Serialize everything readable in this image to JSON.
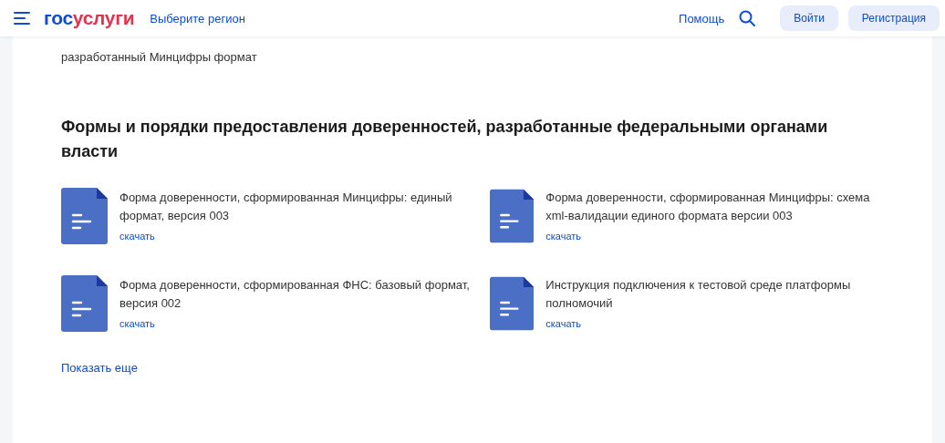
{
  "header": {
    "logo": {
      "first": "гос",
      "second": "услуги"
    },
    "region": "Выберите регион",
    "help": "Помощь",
    "buttons": [
      "Войти",
      "Регистрация"
    ]
  },
  "intro": "разработанный Минцифры формат",
  "section": {
    "title": "Формы и порядки предоставления доверенностей, разработанные федеральными органами власти",
    "documents": [
      {
        "title": "Форма доверенности, сформированная Минцифры: единый формат, версия 003",
        "link": "скачать"
      },
      {
        "title": "Форма доверенности, сформированная Минцифры: схема xml-валидации единого формата версии 003",
        "link": "скачать"
      },
      {
        "title": "Форма доверенности, сформированная ФНС: базовый формат, версия 002",
        "link": "скачать"
      },
      {
        "title": "Инструкция подключения к тестовой среде платформы полномочий",
        "link": "скачать"
      }
    ],
    "more": "Показать еще"
  }
}
